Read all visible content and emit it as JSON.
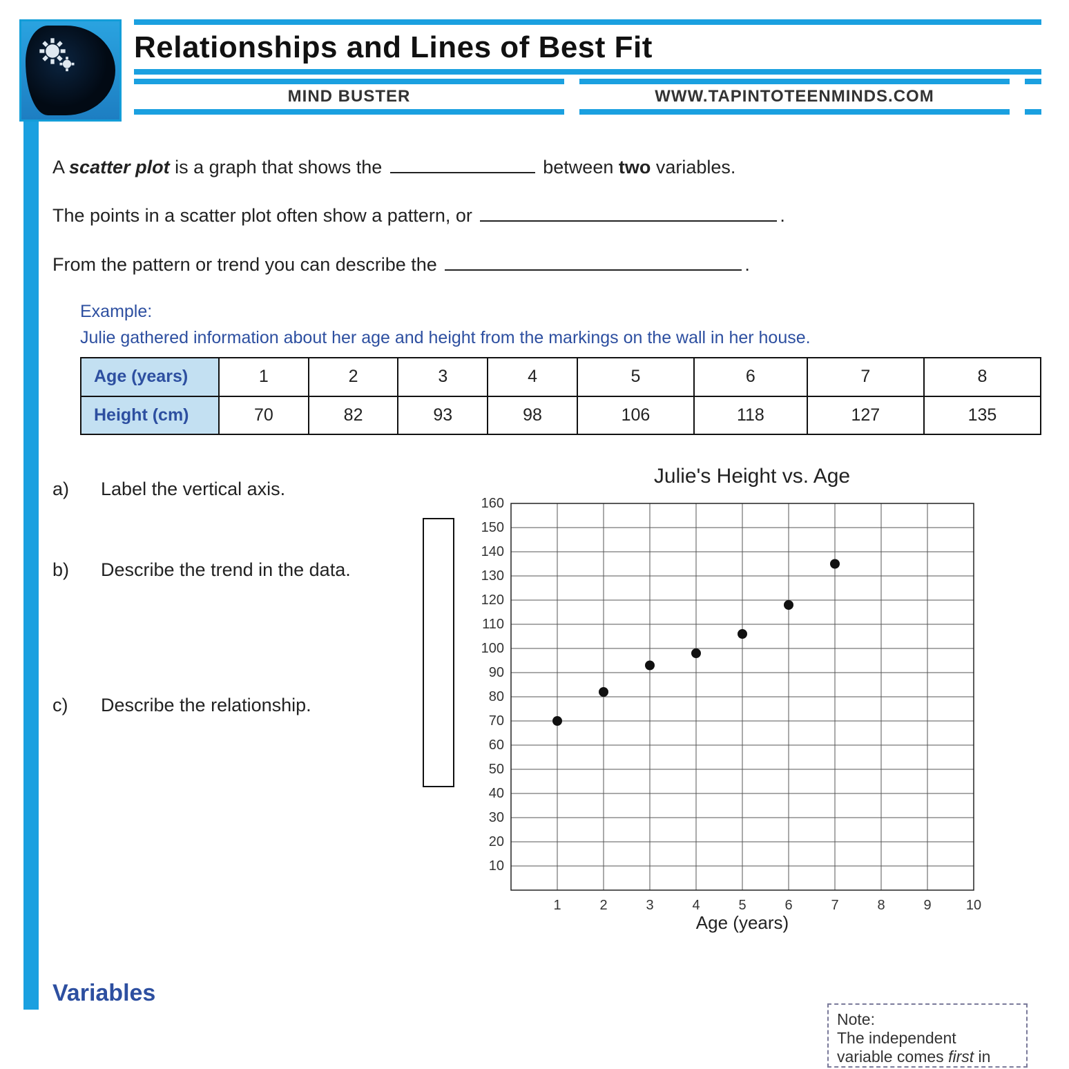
{
  "header": {
    "title": "Relationships and Lines of Best Fit",
    "subtitle_left": "MIND BUSTER",
    "subtitle_right": "WWW.TAPINTOTEENMINDS.COM"
  },
  "intro": {
    "line1_a": "A ",
    "line1_b": "scatter plot",
    "line1_c": " is a graph that shows the ",
    "line1_d": " between ",
    "line1_e": "two",
    "line1_f": " variables.",
    "line2_a": "The points in a scatter plot often show a pattern, or ",
    "line2_b": ".",
    "line3_a": "From the pattern or trend you can describe the ",
    "line3_b": "."
  },
  "example": {
    "label": "Example:",
    "text": "Julie gathered information about her age and height from the markings on the wall in her house.",
    "row1_header": "Age (years)",
    "row2_header": "Height (cm)",
    "ages": [
      "1",
      "2",
      "3",
      "4",
      "5",
      "6",
      "7",
      "8"
    ],
    "heights": [
      "70",
      "82",
      "93",
      "98",
      "106",
      "118",
      "127",
      "135"
    ]
  },
  "questions": {
    "a_letter": "a)",
    "a_text": "Label the vertical axis.",
    "b_letter": "b)",
    "b_text": "Describe the trend in the data.",
    "c_letter": "c)",
    "c_text": "Describe the relationship."
  },
  "section": {
    "variables": "Variables"
  },
  "note": {
    "title": "Note:",
    "line1": "The independent",
    "line2a": "variable comes ",
    "line2b": "first",
    "line2c": " in"
  },
  "chart_data": {
    "type": "scatter",
    "title": "Julie's Height vs. Age",
    "xlabel": "Age (years)",
    "ylabel": "",
    "xlim": [
      0,
      10
    ],
    "ylim": [
      0,
      160
    ],
    "xticks": [
      1,
      2,
      3,
      4,
      5,
      6,
      7,
      8,
      9,
      10
    ],
    "yticks": [
      10,
      20,
      30,
      40,
      50,
      60,
      70,
      80,
      90,
      100,
      110,
      120,
      130,
      140,
      150,
      160
    ],
    "series": [
      {
        "name": "Height",
        "x": [
          1,
          2,
          3,
          4,
          5,
          6,
          7
        ],
        "y": [
          70,
          82,
          93,
          98,
          106,
          118,
          135
        ]
      }
    ]
  }
}
